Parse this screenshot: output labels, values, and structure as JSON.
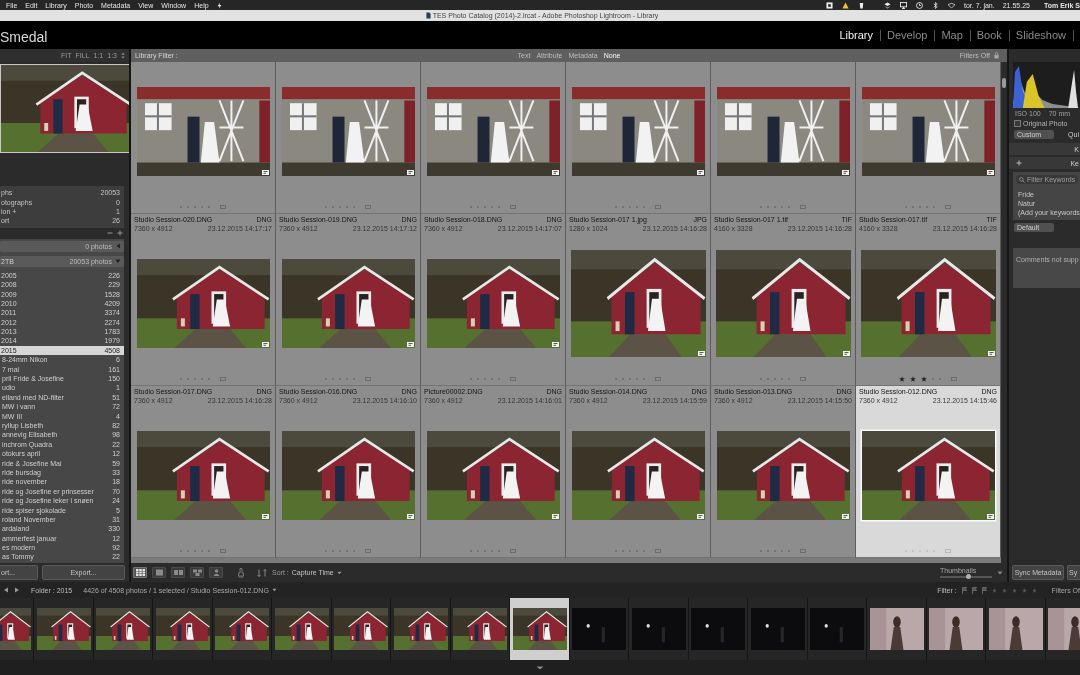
{
  "menubar": {
    "menus": [
      "File",
      "Edit",
      "Library",
      "Photo",
      "Metadata",
      "View",
      "Window",
      "Help"
    ],
    "date": "tor. 7. jan.",
    "time": "21.55.25",
    "user": "Tom Erik S"
  },
  "window": {
    "title": "TES Photo Catalog (2014)-2.lrcat - Adobe Photoshop Lightroom - Library"
  },
  "identity_plate": "Smedal",
  "modules": [
    {
      "label": "Library",
      "selected": true
    },
    {
      "label": "Develop",
      "selected": false
    },
    {
      "label": "Map",
      "selected": false
    },
    {
      "label": "Book",
      "selected": false
    },
    {
      "label": "Slideshow",
      "selected": false
    }
  ],
  "navigator": {
    "zoom_options": [
      "FIT",
      "FILL",
      "1:1",
      "1:3"
    ],
    "preview": {
      "kind": "shed"
    }
  },
  "catalog": [
    {
      "label": "phs",
      "count": "20053"
    },
    {
      "label": "otographs",
      "count": "0"
    },
    {
      "label": "ion +",
      "count": "1"
    },
    {
      "label": "ort",
      "count": "26"
    }
  ],
  "folders": [
    {
      "count": "0 photos",
      "expanded": false
    },
    {
      "label": "2TB",
      "count": "20053 photos",
      "expanded": true,
      "children": [
        {
          "label": "2005",
          "count": "226",
          "selected": false
        },
        {
          "label": "2008",
          "count": "229",
          "selected": false
        },
        {
          "label": "2009",
          "count": "1528",
          "selected": false
        },
        {
          "label": "2010",
          "count": "4209",
          "selected": false
        },
        {
          "label": "2011",
          "count": "3374",
          "selected": false
        },
        {
          "label": "2012",
          "count": "2274",
          "selected": false
        },
        {
          "label": "2013",
          "count": "1783",
          "selected": false
        },
        {
          "label": "2014",
          "count": "1979",
          "selected": false
        },
        {
          "label": "2015",
          "count": "4508",
          "selected": true,
          "children": [
            {
              "label": "8-24mm Nikon",
              "count": "6",
              "selected": false
            },
            {
              "label": "7 mai",
              "count": "161",
              "selected": false
            },
            {
              "label": "pril Fride & Josefine",
              "count": "150",
              "selected": false
            },
            {
              "label": "udio",
              "count": "1",
              "selected": false
            },
            {
              "label": "elland med ND-filter",
              "count": "51",
              "selected": false
            },
            {
              "label": "MW i vann",
              "count": "72",
              "selected": false
            },
            {
              "label": "MW III",
              "count": "4",
              "selected": false
            },
            {
              "label": "ryllup Lisbeth",
              "count": "82",
              "selected": false
            },
            {
              "label": "annevig Elisabeth",
              "count": "98",
              "selected": false
            },
            {
              "label": "inchrom Quadra",
              "count": "22",
              "selected": false
            },
            {
              "label": "otokurs april",
              "count": "12",
              "selected": false
            },
            {
              "label": "ride & Josefine Mai",
              "count": "59",
              "selected": false
            },
            {
              "label": "ride bursdag",
              "count": "33",
              "selected": false
            },
            {
              "label": "ride november",
              "count": "18",
              "selected": false
            },
            {
              "label": "ride og Josefine er prinsesser",
              "count": "70",
              "selected": false
            },
            {
              "label": "ride og Josefine leker i snøen",
              "count": "24",
              "selected": false
            },
            {
              "label": "ride spiser sjokolade",
              "count": "5",
              "selected": false
            },
            {
              "label": "roland November",
              "count": "31",
              "selected": false
            },
            {
              "label": "ardaland",
              "count": "330",
              "selected": false
            },
            {
              "label": "ammerfest januar",
              "count": "12",
              "selected": false
            },
            {
              "label": "es modern",
              "count": "92",
              "selected": false
            },
            {
              "label": "as Tommy",
              "count": "22",
              "selected": false
            }
          ]
        }
      ]
    }
  ],
  "panel_buttons": {
    "import": "ort...",
    "export": "Export..."
  },
  "filter_bar": {
    "label": "Library Filter :",
    "tabs": [
      {
        "label": "Text",
        "selected": false
      },
      {
        "label": "Attribute",
        "selected": false
      },
      {
        "label": "Metadata",
        "selected": false
      },
      {
        "label": "None",
        "selected": true
      }
    ],
    "status": "Filters Off"
  },
  "grid": {
    "rows": [
      [
        {
          "kind": "wall",
          "stars": 0,
          "selected": false
        },
        {
          "kind": "wall",
          "stars": 0,
          "selected": false
        },
        {
          "kind": "wall",
          "stars": 0,
          "selected": false
        },
        {
          "kind": "wall",
          "stars": 0,
          "selected": false
        },
        {
          "kind": "wall",
          "stars": 0,
          "selected": false
        },
        {
          "kind": "wall",
          "stars": 0,
          "selected": false
        }
      ],
      [
        {
          "kind": "shed",
          "name": "Studio Session-020.DNG",
          "format": "DNG",
          "dimensions": "7360 x 4912",
          "date": "23.12.2015 14:17:17",
          "stars": 0,
          "selected": false
        },
        {
          "kind": "shed",
          "name": "Studio Session-019.DNG",
          "format": "DNG",
          "dimensions": "7360 x 4912",
          "date": "23.12.2015 14:17:12",
          "stars": 0,
          "selected": false
        },
        {
          "kind": "shed",
          "name": "Studio Session-018.DNG",
          "format": "DNG",
          "dimensions": "7360 x 4912",
          "date": "23.12.2015 14:17:07",
          "stars": 0,
          "selected": false
        },
        {
          "kind": "shed-close",
          "name": "Studio Session-017 1.jpg",
          "format": "JPG",
          "dimensions": "1280 x 1024",
          "date": "23.12.2015 14:16:28",
          "stars": 0,
          "selected": false
        },
        {
          "kind": "shed-close",
          "name": "Studio Session-017 1.tif",
          "format": "TIF",
          "dimensions": "4160 x 3328",
          "date": "23.12.2015 14:16:28",
          "stars": 0,
          "selected": false
        },
        {
          "kind": "shed-close",
          "name": "Studio Session-017.tif",
          "format": "TIF",
          "dimensions": "4160 x 3328",
          "date": "23.12.2015 14:16:28",
          "stars": 3,
          "selected": false
        }
      ],
      [
        {
          "kind": "shed",
          "name": "Studio Session-017.DNG",
          "format": "DNG",
          "dimensions": "7360 x 4912",
          "date": "23.12.2015 14:16:28",
          "stars": 0,
          "selected": false
        },
        {
          "kind": "shed",
          "name": "Studio Session-016.DNG",
          "format": "DNG",
          "dimensions": "7360 x 4912",
          "date": "23.12.2015 14:16:10",
          "stars": 0,
          "selected": false
        },
        {
          "kind": "shed",
          "name": "Picture00002.DNG",
          "format": "DNG",
          "dimensions": "7360 x 4912",
          "date": "23.12.2015 14:16:01",
          "stars": 0,
          "selected": false
        },
        {
          "kind": "shed",
          "name": "Studio Session-014.DNG",
          "format": "DNG",
          "dimensions": "7360 x 4912",
          "date": "23.12.2015 14:15:59",
          "stars": 0,
          "selected": false
        },
        {
          "kind": "shed",
          "name": "Studio Session-013.DNG",
          "format": "DNG",
          "dimensions": "7360 x 4912",
          "date": "23.12.2015 14:15:50",
          "stars": 0,
          "selected": false
        },
        {
          "kind": "shed",
          "name": "Studio Session-012.DNG",
          "format": "DNG",
          "dimensions": "7360 x 4912",
          "date": "23.12.2015 14:15:46",
          "stars": 0,
          "selected": true
        }
      ]
    ]
  },
  "toolbar": {
    "view_modes": [
      {
        "kind": "grid",
        "selected": true
      },
      {
        "kind": "loupe",
        "selected": false
      },
      {
        "kind": "compare",
        "selected": false
      },
      {
        "kind": "survey",
        "selected": false
      },
      {
        "kind": "people",
        "selected": false
      }
    ],
    "sort_label": "Sort :",
    "sort_value": "Capture Time",
    "thumbnails": {
      "label": "Thumbnails",
      "level": 0.55
    }
  },
  "right_panel": {
    "histogram_info": [
      "ISO 100",
      "70 mm"
    ],
    "original_photo": {
      "label": "Original Photo",
      "checked": false
    },
    "preset": "Custom",
    "quick_develop_header": "Qui",
    "keywording_header": "K",
    "keyword_list_header": "Ke",
    "keyword_filter": {
      "placeholder": "Filter Keywords"
    },
    "keywords": [
      "Fride",
      "Natur",
      "(Add your keywords"
    ],
    "keyword_set": "Default",
    "comments": "Comments not supp",
    "buttons": [
      "Sync Metadata",
      "Sy"
    ]
  },
  "status_bar": {
    "source": "Folder : 2015",
    "info": "4426 of 4508 photos / 1 selected / Studio Session-012.DNG",
    "filter_label": "Filter :",
    "filter_status": "Filters Of"
  },
  "filmstrip": [
    {
      "kind": "shed",
      "selected": false
    },
    {
      "kind": "shed",
      "selected": false
    },
    {
      "kind": "shed",
      "selected": false
    },
    {
      "kind": "shed",
      "selected": false
    },
    {
      "kind": "shed",
      "selected": false
    },
    {
      "kind": "shed",
      "selected": false
    },
    {
      "kind": "shed",
      "selected": false
    },
    {
      "kind": "shed",
      "selected": false
    },
    {
      "kind": "shed",
      "selected": false
    },
    {
      "kind": "shed",
      "selected": true
    },
    {
      "kind": "night",
      "selected": false
    },
    {
      "kind": "night",
      "selected": false
    },
    {
      "kind": "night",
      "selected": false
    },
    {
      "kind": "night",
      "selected": false
    },
    {
      "kind": "night",
      "selected": false
    },
    {
      "kind": "portrait",
      "selected": false
    },
    {
      "kind": "portrait",
      "selected": false
    },
    {
      "kind": "portrait",
      "selected": false
    },
    {
      "kind": "portrait",
      "selected": false
    }
  ]
}
